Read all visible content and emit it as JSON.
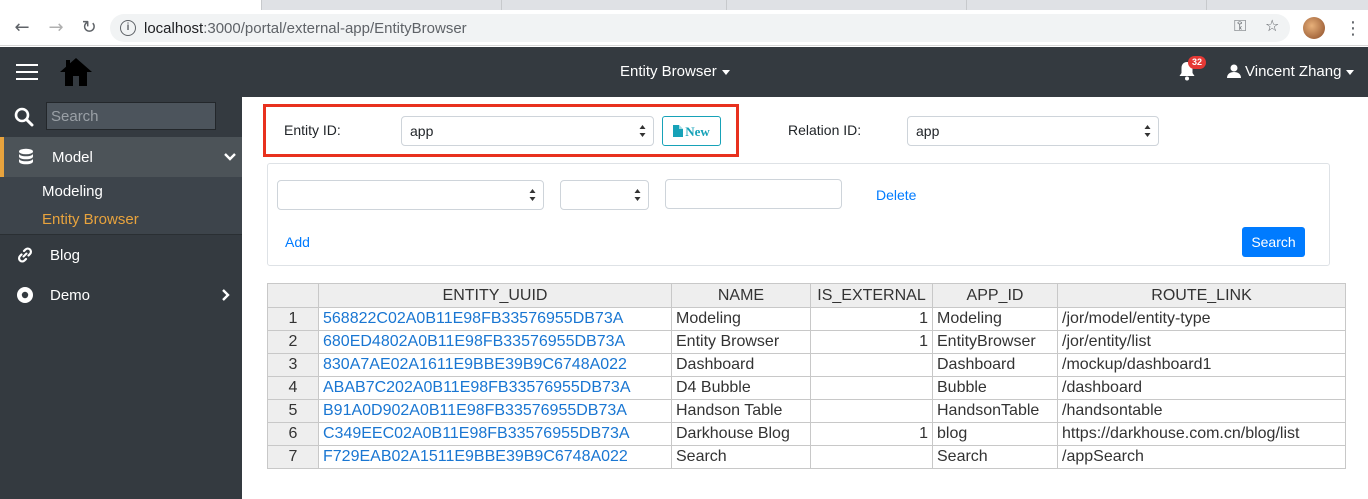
{
  "browser": {
    "url_host": "localhost",
    "url_path": ":3000/portal/external-app/EntityBrowser"
  },
  "header": {
    "title": "Entity Browser",
    "notification_count": "32",
    "user_name": "Vincent Zhang"
  },
  "sidebar": {
    "search_placeholder": "Search",
    "items": [
      {
        "label": "Model",
        "icon": "database-icon",
        "expanded": true
      },
      {
        "label": "Blog",
        "icon": "link-icon"
      },
      {
        "label": "Demo",
        "icon": "circle-dot-icon"
      }
    ],
    "sub_items": [
      {
        "label": "Modeling",
        "active": false
      },
      {
        "label": "Entity Browser",
        "active": true
      }
    ]
  },
  "form": {
    "entity_id_label": "Entity ID:",
    "entity_id_value": "app",
    "new_button": "New",
    "relation_id_label": "Relation ID:",
    "relation_id_value": "app",
    "delete_link": "Delete",
    "add_link": "Add",
    "search_button": "Search"
  },
  "table": {
    "columns": [
      "",
      "ENTITY_UUID",
      "NAME",
      "IS_EXTERNAL",
      "APP_ID",
      "ROUTE_LINK"
    ],
    "rows": [
      {
        "n": "1",
        "uuid": "568822C02A0B11E98FB33576955DB73A",
        "name": "Modeling",
        "is_external": "1",
        "app_id": "Modeling",
        "route": "/jor/model/entity-type"
      },
      {
        "n": "2",
        "uuid": "680ED4802A0B11E98FB33576955DB73A",
        "name": "Entity Browser",
        "is_external": "1",
        "app_id": "EntityBrowser",
        "route": "/jor/entity/list"
      },
      {
        "n": "3",
        "uuid": "830A7AE02A1611E9BBE39B9C6748A022",
        "name": "Dashboard",
        "is_external": "",
        "app_id": "Dashboard",
        "route": "/mockup/dashboard1"
      },
      {
        "n": "4",
        "uuid": "ABAB7C202A0B11E98FB33576955DB73A",
        "name": "D4 Bubble",
        "is_external": "",
        "app_id": "Bubble",
        "route": "/dashboard"
      },
      {
        "n": "5",
        "uuid": "B91A0D902A0B11E98FB33576955DB73A",
        "name": "Handson Table",
        "is_external": "",
        "app_id": "HandsonTable",
        "route": "/handsontable"
      },
      {
        "n": "6",
        "uuid": "C349EEC02A0B11E98FB33576955DB73A",
        "name": "Darkhouse Blog",
        "is_external": "1",
        "app_id": "blog",
        "route": "https://darkhouse.com.cn/blog/list"
      },
      {
        "n": "7",
        "uuid": "F729EAB02A1511E9BBE39B9C6748A022",
        "name": "Search",
        "is_external": "",
        "app_id": "Search",
        "route": "/appSearch"
      }
    ]
  },
  "colors": {
    "header_bg": "#343a40",
    "accent": "#e8a33d",
    "highlight_border": "#e8311e",
    "link": "#007bff"
  }
}
